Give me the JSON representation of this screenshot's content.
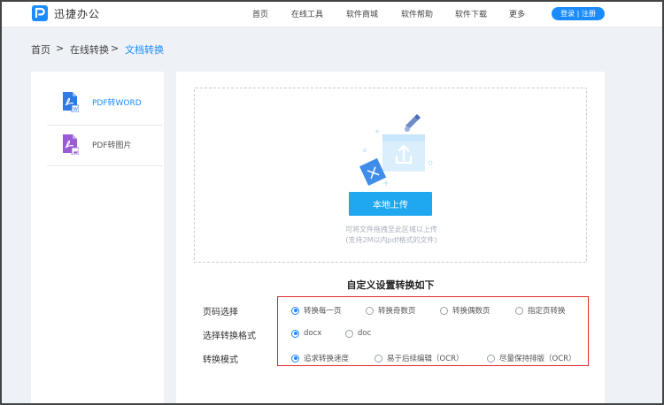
{
  "header": {
    "brand": "迅捷办公",
    "nav": [
      "首页",
      "在线工具",
      "软件商城",
      "软件帮助",
      "软件下载",
      "更多"
    ],
    "login": "登录 | 注册"
  },
  "breadcrumb": {
    "home": "首页",
    "sep1": ">",
    "tools": "在线转换",
    "sep2": ">",
    "current": "文档转换"
  },
  "sidebar": {
    "items": [
      {
        "label": "PDF转WORD",
        "icon": "pdf-word-icon",
        "active": true
      },
      {
        "label": "PDF转图片",
        "icon": "pdf-image-icon",
        "active": false
      }
    ]
  },
  "upload": {
    "button": "本地上传",
    "hint1": "可将文件拖拽至此区域以上传",
    "hint2": "(支持2M以内pdf格式的文件)"
  },
  "settings": {
    "title": "自定义设置转换如下",
    "rows": [
      {
        "label": "页码选择",
        "options": [
          "转换每一页",
          "转换奇数页",
          "转换偶数页",
          "指定页转换"
        ],
        "selected": 0
      },
      {
        "label": "选择转换格式",
        "options": [
          "docx",
          "doc"
        ],
        "selected": 0
      },
      {
        "label": "转换模式",
        "options": [
          "追求转换速度",
          "易于后续编辑（OCR）",
          "尽量保持排版（OCR）"
        ],
        "selected": 0
      }
    ]
  },
  "colors": {
    "accent": "#1a8cff",
    "upload_button": "#1fa8f0",
    "highlight": "#e02b2b"
  }
}
